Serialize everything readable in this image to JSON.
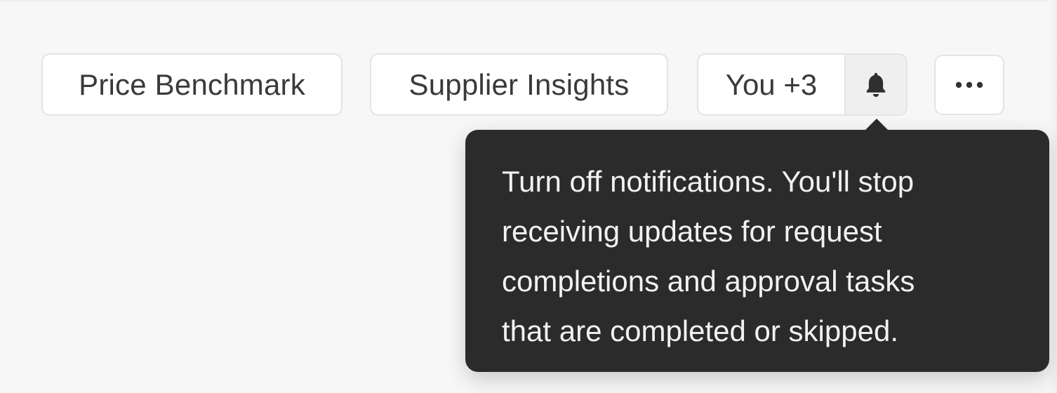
{
  "toolbar": {
    "price_benchmark_label": "Price Benchmark",
    "supplier_insights_label": "Supplier Insights",
    "followers_label": "You +3",
    "bell_icon": "bell-icon",
    "more_icon": "ellipsis-icon"
  },
  "tooltip": {
    "lines": [
      "Turn off notifications. You'll stop",
      "receiving updates for request",
      "completions and approval tasks",
      "that are completed or skipped."
    ]
  },
  "colors": {
    "background": "#f7f7f7",
    "tooltip_bg": "#2b2b2b",
    "tooltip_text": "#f2f2f2",
    "button_text": "#3a3a3a",
    "button_border": "#e3e3e3",
    "bell_bg": "#efefef"
  }
}
